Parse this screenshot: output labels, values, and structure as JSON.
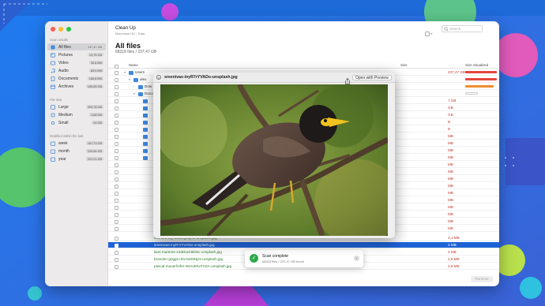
{
  "window": {
    "title": "Clean Up",
    "breadcrumb": "Macintosh HD › Data",
    "search_placeholder": "Search"
  },
  "sidebar": {
    "scan_results_heading": "Scan results",
    "scan_results": [
      {
        "label": "All files",
        "size": "237,47 GB",
        "icon": "all-files-icon"
      },
      {
        "label": "Pictures",
        "size": "13,75 GB",
        "icon": "pictures-icon"
      },
      {
        "label": "Video",
        "size": "30,8 MB",
        "icon": "video-icon"
      },
      {
        "label": "Audio",
        "size": "89,9 MB",
        "icon": "audio-icon"
      },
      {
        "label": "Documents",
        "size": "166,8 MB",
        "icon": "documents-icon"
      },
      {
        "label": "Archives",
        "size": "165,65 GB",
        "icon": "archives-icon"
      }
    ],
    "file_size_heading": "File size",
    "file_sizes": [
      {
        "label": "Large",
        "size": "209,78 GB"
      },
      {
        "label": "Medium",
        "size": "1,68 GB"
      },
      {
        "label": "Small",
        "size": "26 GB"
      }
    ],
    "modified_heading": "Modified within the last",
    "modified": [
      {
        "label": "week",
        "size": "167,73 GB"
      },
      {
        "label": "month",
        "size": "109,54 GB"
      },
      {
        "label": "year",
        "size": "221,21 GB"
      }
    ]
  },
  "main": {
    "title": "All files",
    "subtitle": "68318 files / 237,47 GB",
    "columns": {
      "name": "Name",
      "size": "Size",
      "size_visualized": "Size visualized"
    },
    "rows": [
      {
        "name": "Users",
        "size": "237,47 GB"
      },
      {
        "name": "alex",
        "size": ""
      },
      {
        "name": "Dow",
        "size": ""
      },
      {
        "name": "Docu",
        "size": ""
      },
      {
        "name": "clement-roy-MUeeyzsjiY8-unsplash.jpg",
        "size": "3,1 MB"
      },
      {
        "name": "sreenivas-inyR7rYVADo-unsplash.jpg",
        "size": "3 MB"
      },
      {
        "name": "liam-martens-1mBKaG9i6Nc-unsplash.jpg",
        "size": "3 MB"
      },
      {
        "name": "brandon-griggs-uhL0vD5Njzs-unsplash.jpg",
        "size": "2,8 MB"
      },
      {
        "name": "pascal-mauerhofer-W1ruEhoTH2A-unsplash.jpg",
        "size": "2,8 MB"
      }
    ],
    "hidden_sizes": [
      "7 GB",
      "GB",
      "GB",
      "B",
      "B",
      "MB",
      "MB",
      "MB",
      "MB",
      "MB",
      "MB",
      "MB",
      "MB",
      "MB",
      "MB",
      "MB",
      "MB",
      "MB",
      "MB"
    ],
    "remove_label": "Remove"
  },
  "toast": {
    "title": "Scan complete",
    "subtitle": "68318 files / 237,47 GB found"
  },
  "preview": {
    "title": "sreenivas-inyR7rYVADo-unsplash.jpg",
    "open_label": "Open with Preview"
  },
  "colors": {
    "accent": "#1e63d6",
    "size_bar_red": "#e5463b",
    "size_bar_orange": "#ee8b2f",
    "success": "#2eaa4a"
  }
}
